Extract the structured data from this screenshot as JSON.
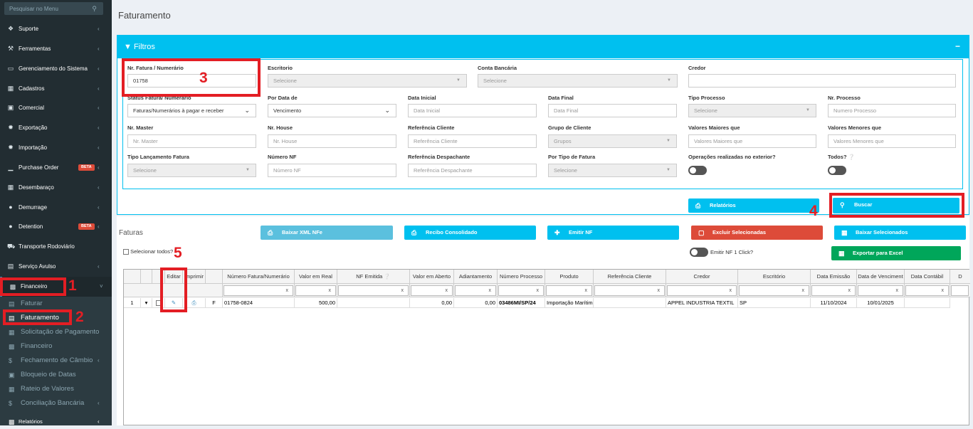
{
  "sidebar": {
    "search_placeholder": "Pesquisar no Menu",
    "items": [
      {
        "label": "Suporte",
        "icon": "support-icon"
      },
      {
        "label": "Ferramentas",
        "icon": "wrench-icon"
      },
      {
        "label": "Gerenciamento do Sistema",
        "icon": "monitor-icon"
      },
      {
        "label": "Cadastros",
        "icon": "book-icon"
      },
      {
        "label": "Comercial",
        "icon": "briefcase-icon"
      },
      {
        "label": "Exportação",
        "icon": "export-icon"
      },
      {
        "label": "Importação",
        "icon": "import-icon"
      },
      {
        "label": "Purchase Order",
        "icon": "chart-icon",
        "badge": "BETA"
      },
      {
        "label": "Desembaraço",
        "icon": "calculator-icon"
      },
      {
        "label": "Demurrage",
        "icon": "users-icon"
      },
      {
        "label": "Detention",
        "icon": "users-icon",
        "badge": "BETA"
      },
      {
        "label": "Transporte Rodoviário",
        "icon": "truck-icon"
      },
      {
        "label": "Serviço Avulso",
        "icon": "file-icon"
      },
      {
        "label": "Financeiro",
        "icon": "money-icon"
      }
    ],
    "sub_items": [
      {
        "label": "Faturar"
      },
      {
        "label": "Faturamento"
      },
      {
        "label": "Solicitação de Pagamento"
      },
      {
        "label": "Financeiro"
      },
      {
        "label": "Fechamento de Câmbio"
      },
      {
        "label": "Bloqueio de Datas"
      },
      {
        "label": "Rateio de Valores"
      },
      {
        "label": "Conciliação Bancária"
      }
    ],
    "last_item": "Relatórios"
  },
  "annotations": [
    "1",
    "2",
    "3",
    "4",
    "5"
  ],
  "page_title": "Faturamento",
  "filters": {
    "title": "Filtros",
    "collapse": "−",
    "nr_fatura": {
      "label": "Nr. Fatura / Numerário",
      "value": "01758"
    },
    "escritorio": {
      "label": "Escritorio",
      "value": "Selecione"
    },
    "conta_bancaria": {
      "label": "Conta Bancária",
      "value": "Selecione"
    },
    "credor": {
      "label": "Credor",
      "value": ""
    },
    "status_fatura": {
      "label": "Status Fatura/ Numerário",
      "value": "Faturas/Numerários à pagar e receber"
    },
    "por_data_de": {
      "label": "Por Data de",
      "value": "Vencimento"
    },
    "data_inicial": {
      "label": "Data Inicial",
      "placeholder": "Data Inicial"
    },
    "data_final": {
      "label": "Data Final",
      "placeholder": "Data Final"
    },
    "tipo_processo": {
      "label": "Tipo Processo",
      "value": "Selecione"
    },
    "nr_processo": {
      "label": "Nr. Processo",
      "placeholder": "Numero Processo"
    },
    "nr_master": {
      "label": "Nr. Master",
      "placeholder": "Nr. Master"
    },
    "nr_house": {
      "label": "Nr. House",
      "placeholder": "Nr. House"
    },
    "referencia_cliente": {
      "label": "Referência Cliente",
      "placeholder": "Referência Cliente"
    },
    "grupo_cliente": {
      "label": "Grupo de Cliente",
      "value": "Grupos"
    },
    "valores_maiores": {
      "label": "Valores Maiores que",
      "placeholder": "Valores Maiores que"
    },
    "valores_menores": {
      "label": "Valores Menores que",
      "placeholder": "Valores Menores que"
    },
    "tipo_lancamento": {
      "label": "Tipo Lançamento Fatura",
      "value": "Selecione"
    },
    "numero_nf": {
      "label": "Número NF",
      "placeholder": "Número NF"
    },
    "referencia_despachante": {
      "label": "Referência Despachante",
      "placeholder": "Referência Despachante"
    },
    "tipo_fatura": {
      "label": "Por Tipo de Fatura",
      "value": "Selecione"
    },
    "operacoes_exterior": {
      "label": "Operações realizadas no exterior?",
      "on": false
    },
    "todos": {
      "label": "Todos?",
      "on": false
    },
    "relatorios_button": "Relatórios",
    "buscar_button": "Buscar"
  },
  "faturas": {
    "title": "Faturas",
    "buttons": {
      "baixar_xml": "Baixar XML NFe",
      "recibo": "Recibo Consolidado",
      "emitir_nf": "Emitir NF",
      "excluir": "Excluir Selecionadas",
      "baixar_sel": "Baixar Selecionados",
      "exportar_excel": "Exportar para Excel"
    },
    "selecionar_todos": "Selecionar todos?",
    "emitir_nf_click": "Emitir NF 1 Click?",
    "columns": [
      "Editar",
      "Imprimir",
      "Número Fatura/Numerário",
      "Valor em Real",
      "NF Emitida",
      "Valor em Aberto",
      "Adiantamento",
      "Número Processo",
      "Produto",
      "Referência Cliente",
      "Credor",
      "Escritório",
      "Data Emissão",
      "Data de Venciment",
      "Data Contábil",
      "D"
    ],
    "filter_clear": "x",
    "row": {
      "index": "1",
      "expand": "▾",
      "type": "F",
      "numero": "01758-0824",
      "valor_real": "500,00",
      "nf_emitida": "",
      "valor_aberto": "0,00",
      "adiantamento": "0,00",
      "processo": "03486MI/SP/24",
      "produto": "Importação Marítima",
      "ref_cliente": "",
      "credor": "APPEL INDUSTRIA TEXTIL",
      "escritorio": "SP",
      "data_emissao": "11/10/2024",
      "data_vencimento": "10/01/2025",
      "data_contabil": ""
    }
  },
  "colors": {
    "sidebar_bg": "#222d32",
    "filter_header": "#00c0ef",
    "buscar": "#00c0ef",
    "excluir": "#dd4b39",
    "excel": "#00a65a",
    "highlight": "#e31e24"
  }
}
